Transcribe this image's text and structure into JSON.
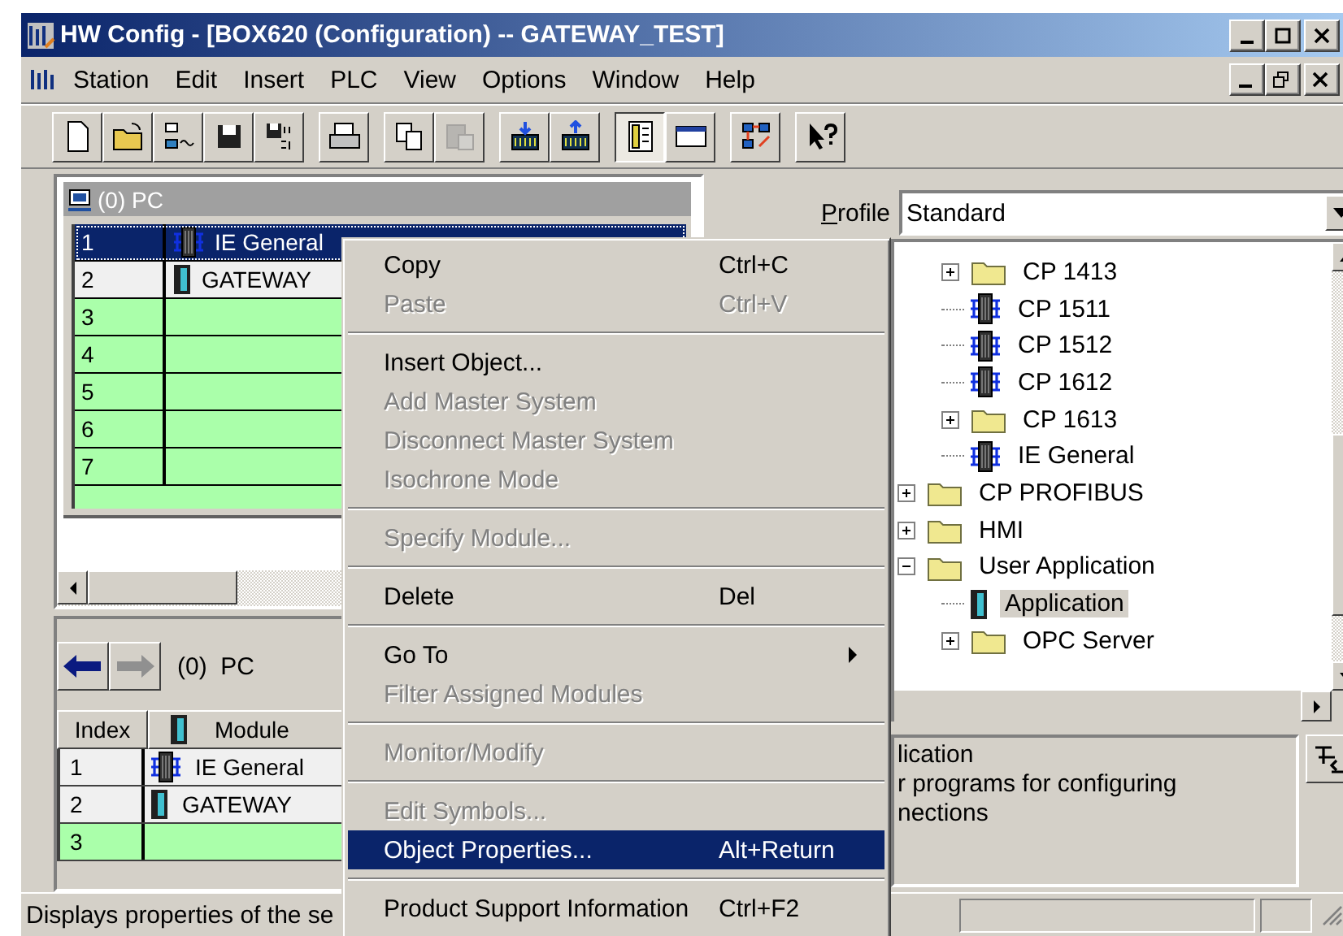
{
  "window": {
    "title": "HW Config - [BOX620 (Configuration) -- GATEWAY_TEST]"
  },
  "menu_bar": [
    "Station",
    "Edit",
    "Insert",
    "PLC",
    "View",
    "Options",
    "Window",
    "Help"
  ],
  "toolbar": [
    [
      {
        "kind": "new",
        "pressed": false,
        "disabled": false
      },
      {
        "kind": "open",
        "pressed": false,
        "disabled": false
      },
      {
        "kind": "network",
        "pressed": false,
        "disabled": false
      },
      {
        "kind": "save",
        "pressed": false,
        "disabled": false
      },
      {
        "kind": "compile",
        "pressed": false,
        "disabled": false
      }
    ],
    [
      {
        "kind": "print",
        "pressed": false,
        "disabled": false
      }
    ],
    [
      {
        "kind": "copy",
        "pressed": false,
        "disabled": false
      },
      {
        "kind": "paste",
        "pressed": false,
        "disabled": true
      }
    ],
    [
      {
        "kind": "download",
        "pressed": false,
        "disabled": false
      },
      {
        "kind": "upload",
        "pressed": false,
        "disabled": false
      }
    ],
    [
      {
        "kind": "catalog",
        "pressed": true,
        "disabled": false
      },
      {
        "kind": "panel",
        "pressed": false,
        "disabled": false
      }
    ],
    [
      {
        "kind": "netpro",
        "pressed": false,
        "disabled": false
      }
    ],
    [
      {
        "kind": "help",
        "pressed": false,
        "disabled": false
      }
    ]
  ],
  "rack": {
    "title": "(0) PC",
    "rows": [
      {
        "slot": "1",
        "module": "IE General",
        "kind": "network-module",
        "selected": true
      },
      {
        "slot": "2",
        "module": "GATEWAY",
        "kind": "module",
        "selected": false
      },
      {
        "slot": "3",
        "selected": false
      },
      {
        "slot": "4",
        "selected": false
      },
      {
        "slot": "5",
        "selected": false
      },
      {
        "slot": "6",
        "selected": false
      },
      {
        "slot": "7",
        "selected": false
      }
    ]
  },
  "module_list": {
    "back_enabled": true,
    "forward_enabled": false,
    "station": "(0)  PC",
    "columns": [
      "Index",
      "Module"
    ],
    "rows": [
      {
        "index": "1",
        "module": "IE General",
        "kind": "network-module"
      },
      {
        "index": "2",
        "module": "GATEWAY",
        "kind": "module"
      },
      {
        "index": "3"
      }
    ]
  },
  "catalog": {
    "profile": {
      "label": "Profile",
      "value": "Standard"
    },
    "tree": [
      {
        "children": [
          {
            "label": "CP 1413",
            "kind": "folder",
            "expanded": false,
            "selected": false
          },
          {
            "label": "CP 1511",
            "kind": "network-module",
            "selected": false
          },
          {
            "label": "CP 1512",
            "kind": "network-module",
            "selected": false
          },
          {
            "label": "CP 1612",
            "kind": "network-module",
            "selected": false
          },
          {
            "label": "CP 1613",
            "kind": "folder",
            "expanded": false,
            "selected": false
          },
          {
            "label": "IE General",
            "kind": "network-module",
            "selected": false
          }
        ]
      },
      {
        "label": "CP PROFIBUS",
        "kind": "folder",
        "expanded": false,
        "selected": false
      },
      {
        "label": "HMI",
        "kind": "folder",
        "expanded": false,
        "selected": false
      },
      {
        "label": "User Application",
        "kind": "folder",
        "expanded": true,
        "selected": false,
        "children": [
          {
            "label": "Application",
            "kind": "module",
            "selected": true
          },
          {
            "label": "OPC Server",
            "kind": "folder",
            "expanded": false,
            "selected": false
          }
        ]
      }
    ],
    "info": [
      "lication",
      "r programs for configuring",
      "nections"
    ]
  },
  "status_bar": {
    "text": "Displays properties of the se"
  },
  "context_menu": [
    {
      "kind": "item",
      "label": "Copy",
      "shortcut": "Ctrl+C",
      "disabled": false,
      "selected": false
    },
    {
      "kind": "item",
      "label": "Paste",
      "shortcut": "Ctrl+V",
      "disabled": true,
      "selected": false
    },
    {
      "kind": "separator"
    },
    {
      "kind": "item",
      "label": "Insert Object...",
      "disabled": false,
      "selected": false
    },
    {
      "kind": "item",
      "label": "Add Master System",
      "disabled": true,
      "selected": false
    },
    {
      "kind": "item",
      "label": "Disconnect Master System",
      "disabled": true,
      "selected": false
    },
    {
      "kind": "item",
      "label": "Isochrone Mode",
      "disabled": true,
      "selected": false
    },
    {
      "kind": "separator"
    },
    {
      "kind": "item",
      "label": "Specify Module...",
      "disabled": true,
      "selected": false
    },
    {
      "kind": "separator"
    },
    {
      "kind": "item",
      "label": "Delete",
      "shortcut": "Del",
      "disabled": false,
      "selected": false
    },
    {
      "kind": "separator"
    },
    {
      "kind": "item",
      "label": "Go To",
      "submenu": true,
      "disabled": false,
      "selected": false
    },
    {
      "kind": "item",
      "label": "Filter Assigned Modules",
      "disabled": true,
      "selected": false
    },
    {
      "kind": "separator"
    },
    {
      "kind": "item",
      "label": "Monitor/Modify",
      "disabled": true,
      "selected": false
    },
    {
      "kind": "separator"
    },
    {
      "kind": "item",
      "label": "Edit Symbols...",
      "disabled": true,
      "selected": false
    },
    {
      "kind": "item",
      "label": "Object Properties...",
      "shortcut": "Alt+Return",
      "disabled": false,
      "selected": true
    },
    {
      "kind": "separator"
    },
    {
      "kind": "item",
      "label": "Product Support Information",
      "shortcut": "Ctrl+F2",
      "disabled": false,
      "selected": false
    }
  ]
}
